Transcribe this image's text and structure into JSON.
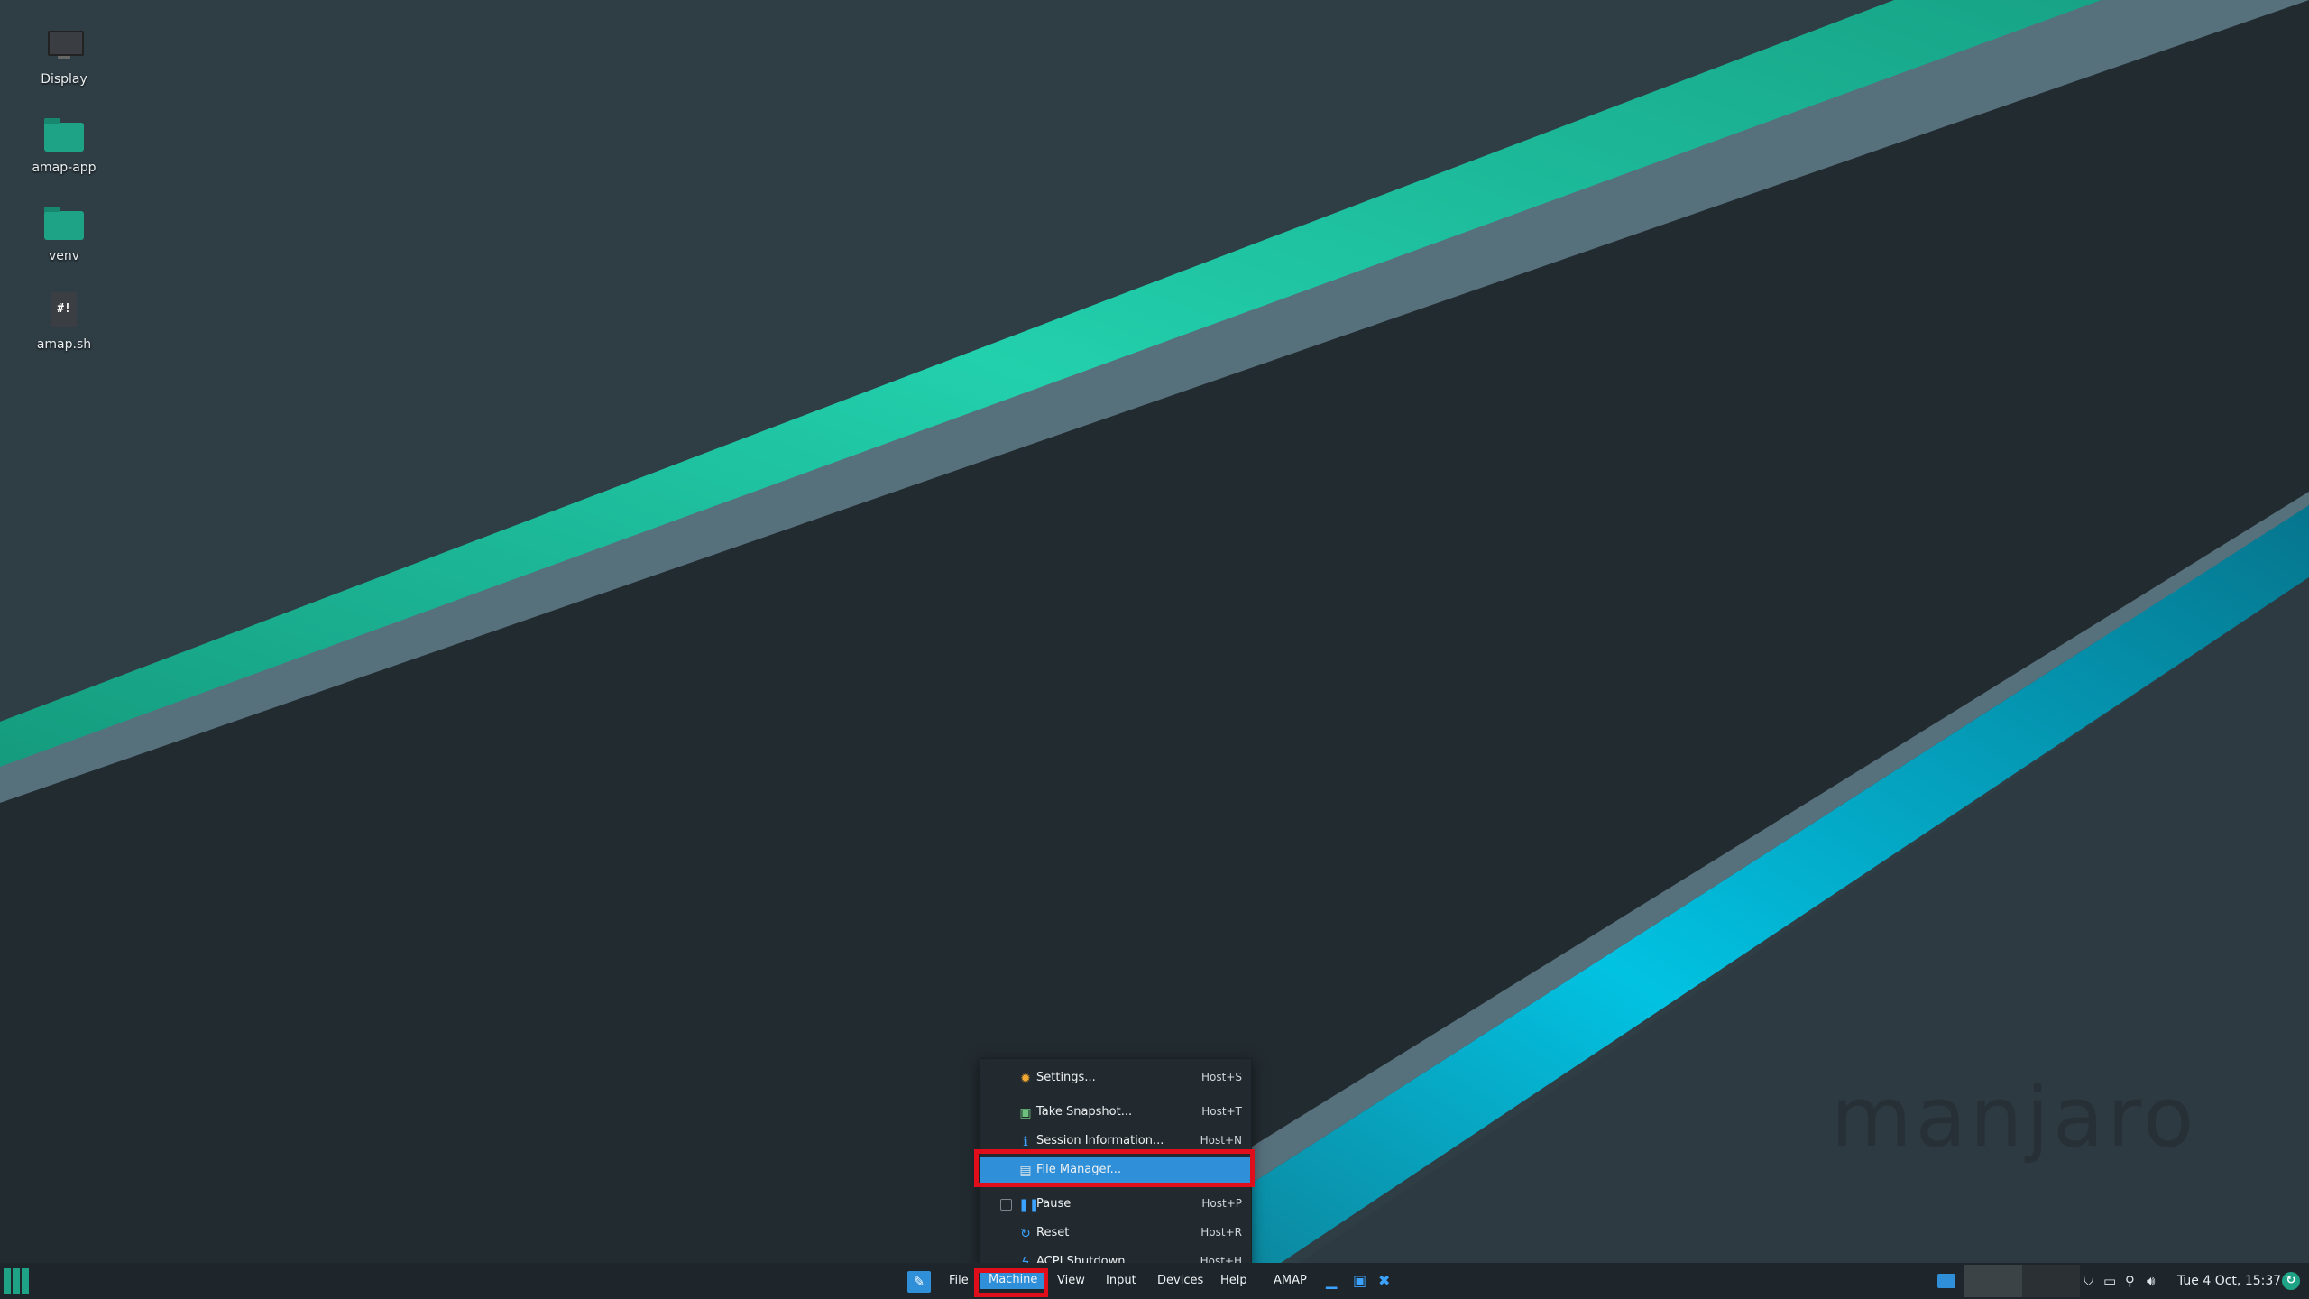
{
  "desktop_icons": [
    {
      "label": "Display",
      "icon": "monitor-icon"
    },
    {
      "label": "amap-app",
      "icon": "folder-icon"
    },
    {
      "label": "venv",
      "icon": "folder-icon"
    },
    {
      "label": "amap.sh",
      "icon": "shell-script-icon",
      "glyph": "#!"
    }
  ],
  "wallpaper": {
    "watermark": "manjaro",
    "colors": {
      "base": "#2b363d",
      "dark": "#222a2f",
      "green": "#1fc9a4",
      "cyan": "#00b6d6",
      "gray": "#56707c"
    }
  },
  "machine_menu": {
    "items": [
      {
        "label": "Settings...",
        "shortcut": "Host+S",
        "icon": "gear-icon"
      },
      {
        "label": "Take Snapshot...",
        "shortcut": "Host+T",
        "icon": "snapshot-icon"
      },
      {
        "label": "Session Information...",
        "shortcut": "Host+N",
        "icon": "info-icon"
      },
      {
        "label": "File Manager...",
        "shortcut": "",
        "icon": "file-manager-icon",
        "active": true
      },
      {
        "label": "Pause",
        "shortcut": "Host+P",
        "icon": "pause-icon",
        "checkbox": true
      },
      {
        "label": "Reset",
        "shortcut": "Host+R",
        "icon": "reset-icon"
      },
      {
        "label": "ACPI Shutdown",
        "shortcut": "Host+H",
        "icon": "power-icon"
      }
    ]
  },
  "taskbar": {
    "menubar": [
      "File",
      "Machine",
      "View",
      "Input",
      "Devices",
      "Help"
    ],
    "active_menu": "Machine",
    "app_title": "AMAP",
    "clock": "Tue 4 Oct, 15:37",
    "accent": "#2f8fd8",
    "highlight": "#e00d1b"
  }
}
